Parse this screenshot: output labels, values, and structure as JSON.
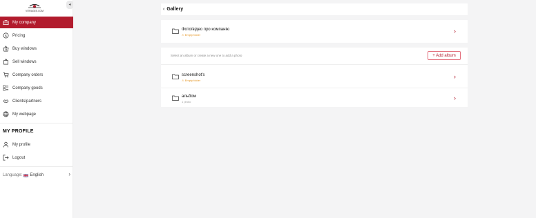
{
  "brand": {
    "logo_text": "VITRAGES.COM",
    "accent": "#b21b2d"
  },
  "sidebar": {
    "collapse_glyph": "◂",
    "items": [
      {
        "label": "My company",
        "icon": "briefcase-icon",
        "active": true
      },
      {
        "label": "Pricing",
        "icon": "dollar-icon"
      },
      {
        "label": "Buy windows",
        "icon": "basket-icon"
      },
      {
        "label": "Sell windows",
        "icon": "shopping-bag-icon"
      },
      {
        "label": "Company orders",
        "icon": "cart-icon"
      },
      {
        "label": "Company goods",
        "icon": "grid-list-icon"
      },
      {
        "label": "Clients/partners",
        "icon": "handshake-icon"
      },
      {
        "label": "My webpage",
        "icon": "globe-icon"
      }
    ],
    "profile_title": "MY PROFILE",
    "profile_items": [
      {
        "label": "My profile",
        "icon": "user-icon"
      },
      {
        "label": "Logout",
        "icon": "logout-icon"
      }
    ],
    "language": {
      "label": "Language:",
      "value": "English",
      "flag": "uk-flag-icon"
    }
  },
  "gallery": {
    "back_glyph": "‹",
    "title": "Gallery",
    "top_album": {
      "title": "Фото/відео про компанію",
      "subtitle": "⚠ Empty folder"
    },
    "hint": "Select an album or create a new one to add a photo",
    "add_button": "+ Add album",
    "albums": [
      {
        "title": "screenshot's",
        "subtitle": "⚠ Empty folder",
        "empty": true
      },
      {
        "title": "альбом",
        "subtitle": "1 photo",
        "empty": false
      }
    ],
    "row_chevron": "›"
  }
}
